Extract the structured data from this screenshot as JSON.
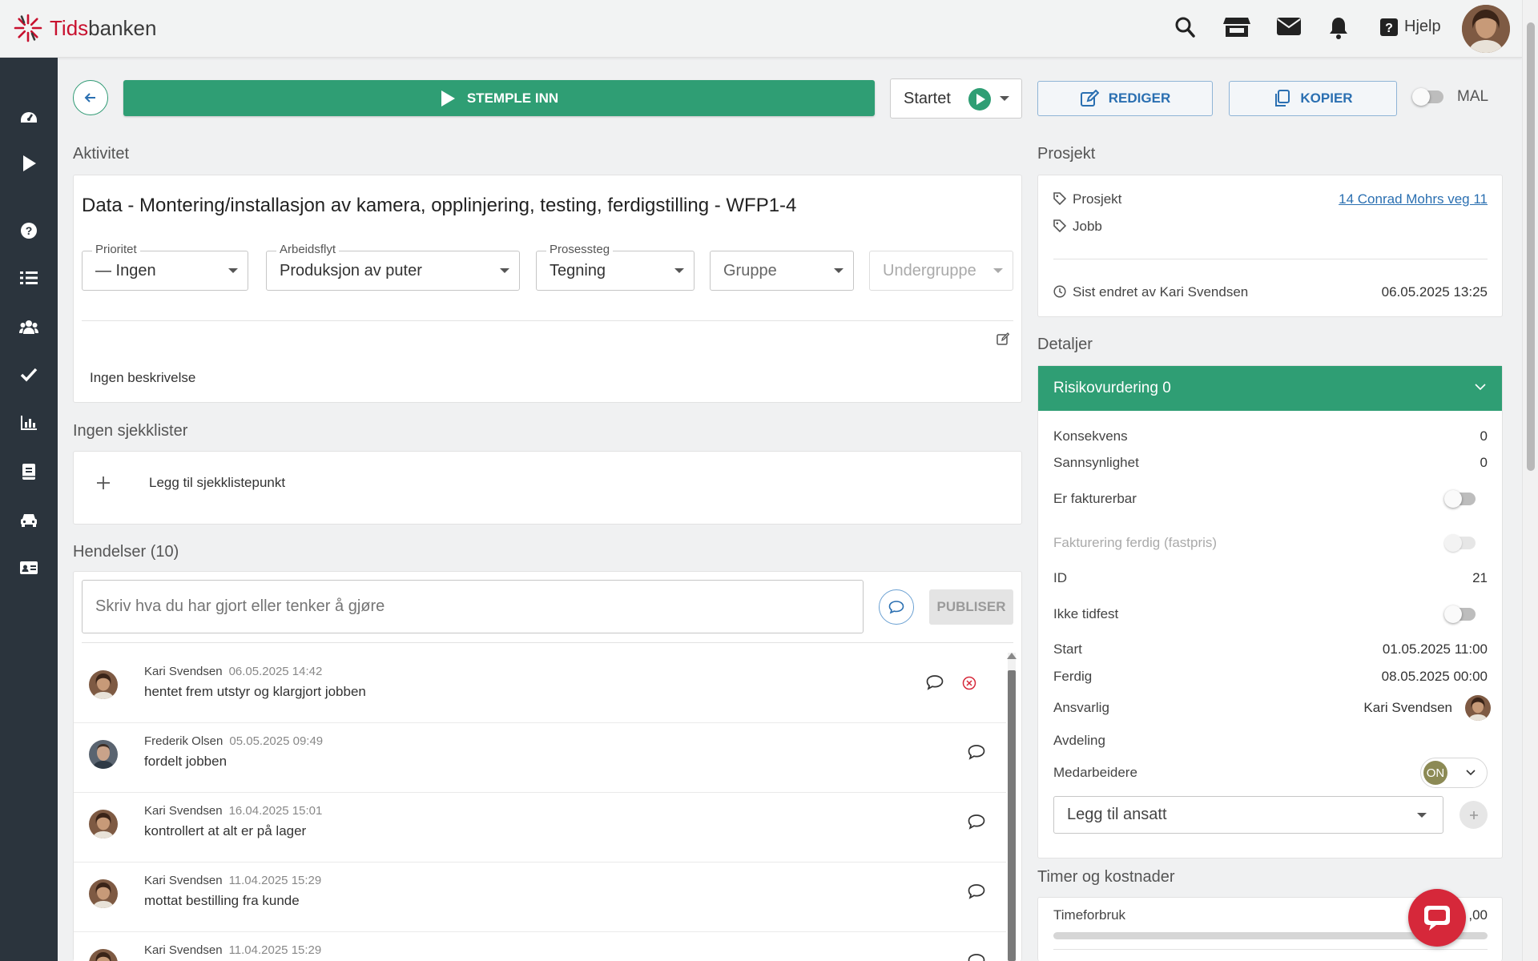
{
  "app": {
    "brand_prefix": "Tids",
    "brand_suffix": "banken",
    "help_label": "Hjelp"
  },
  "actions": {
    "stemple_label": "STEMPLE INN",
    "status_value": "Startet",
    "edit_label": "REDIGER",
    "copy_label": "KOPIER",
    "template_label": "MAL"
  },
  "activity": {
    "heading": "Aktivitet",
    "title": "Data - Montering/installasjon av kamera, opplinjering, testing, ferdigstilling - WFP1-4",
    "fields": {
      "priority": {
        "label": "Prioritet",
        "value": "—  Ingen"
      },
      "workflow": {
        "label": "Arbeidsflyt",
        "value": "Produksjon av puter"
      },
      "step": {
        "label": "Prosessteg",
        "value": "Tegning"
      },
      "group": {
        "placeholder": "Gruppe"
      },
      "subgroup": {
        "placeholder": "Undergruppe"
      }
    },
    "description": "Ingen beskrivelse"
  },
  "checklists": {
    "heading": "Ingen sjekklister",
    "add_label": "Legg til sjekklistepunkt"
  },
  "events": {
    "heading": "Hendelser (10)",
    "input_placeholder": "Skriv hva du har gjort eller tenker å gjøre",
    "publish_label": "PUBLISER",
    "items": [
      {
        "author": "Kari Svendsen",
        "time": "06.05.2025 14:42",
        "text": "hentet frem utstyr og klargjort jobben"
      },
      {
        "author": "Frederik Olsen",
        "time": "05.05.2025 09:49",
        "text": "fordelt jobben"
      },
      {
        "author": "Kari Svendsen",
        "time": "16.04.2025 15:01",
        "text": "kontrollert at alt er på lager"
      },
      {
        "author": "Kari Svendsen",
        "time": "11.04.2025 15:29",
        "text": "mottat bestilling fra kunde"
      },
      {
        "author": "Kari Svendsen",
        "time": "11.04.2025 15:29",
        "text": ""
      }
    ]
  },
  "project": {
    "heading": "Prosjekt",
    "project_label": "Prosjekt",
    "project_value": "14 Conrad Mohrs veg 11",
    "job_label": "Jobb",
    "changed_label": "Sist endret av Kari Svendsen",
    "changed_value": "06.05.2025 13:25"
  },
  "details": {
    "heading": "Detaljer",
    "risk_label": "Risikovurdering 0",
    "konsekvens_label": "Konsekvens",
    "konsekvens_value": "0",
    "sannsynlighet_label": "Sannsynlighet",
    "sannsynlighet_value": "0",
    "fakturerbar_label": "Er fakturerbar",
    "fakturering_label": "Fakturering ferdig (fastpris)",
    "id_label": "ID",
    "id_value": "21",
    "ikke_tidfest_label": "Ikke tidfest",
    "start_label": "Start",
    "start_value": "01.05.2025 11:00",
    "ferdig_label": "Ferdig",
    "ferdig_value": "08.05.2025 00:00",
    "ansvarlig_label": "Ansvarlig",
    "ansvarlig_value": "Kari Svendsen",
    "avdeling_label": "Avdeling",
    "medarbeidere_label": "Medarbeidere",
    "medarbeidere_initials": "ON",
    "add_employee_placeholder": "Legg til ansatt"
  },
  "costs": {
    "heading": "Timer og kostnader",
    "timeforbruk_label": "Timeforbruk",
    "timeforbruk_value": ",00"
  },
  "colors": {
    "primary_green": "#2f9e74",
    "link_blue": "#2a6fb1",
    "brand_red": "#c8102e",
    "sidebar": "#2b343d"
  }
}
